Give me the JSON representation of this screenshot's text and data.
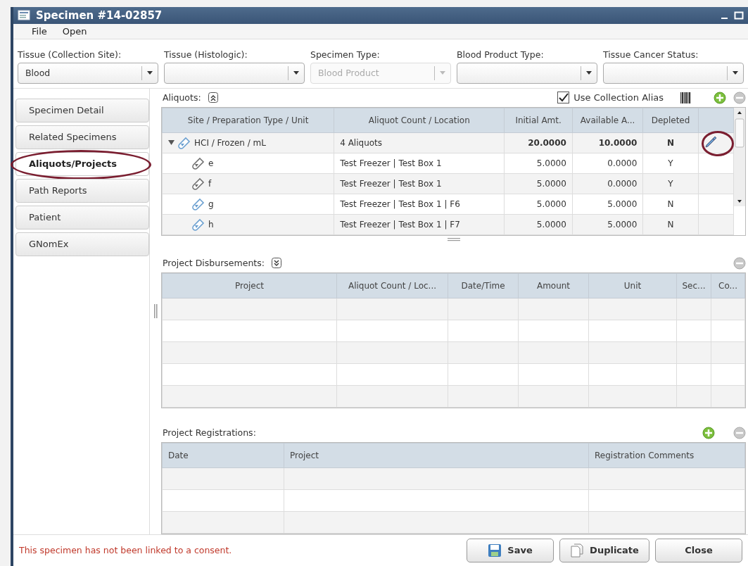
{
  "window": {
    "title": "Specimen #14-02857"
  },
  "menu": [
    "File",
    "Open"
  ],
  "fields": [
    {
      "label": "Tissue (Collection Site):",
      "value": "Blood",
      "disabled": false
    },
    {
      "label": "Tissue (Histologic):",
      "disabled": false
    },
    {
      "label": "Specimen Type:",
      "value": "Blood Product",
      "disabled": true
    },
    {
      "label": "Blood Product Type:",
      "disabled": false
    },
    {
      "label": "Tissue Cancer Status:",
      "disabled": false
    }
  ],
  "sidebar": {
    "items": [
      {
        "label": "Specimen Detail",
        "selected": false,
        "annotated": false
      },
      {
        "label": "Related Specimens",
        "selected": false,
        "annotated": false
      },
      {
        "label": "Aliquots/Projects",
        "selected": true,
        "annotated": true
      },
      {
        "label": "Path Reports",
        "selected": false,
        "annotated": false
      },
      {
        "label": "Patient",
        "selected": false,
        "annotated": false
      },
      {
        "label": "GNomEx",
        "selected": false,
        "annotated": false
      }
    ]
  },
  "aliquots": {
    "title": "Aliquots:",
    "use_collection_alias": {
      "label": "Use Collection Alias",
      "checked": true
    },
    "columns": [
      "Site / Preparation Type / Unit",
      "Aliquot Count / Location",
      "Initial Amt.",
      "Available A...",
      "Depleted"
    ],
    "rows": [
      {
        "kind": "group",
        "site": "HCI / Frozen / mL",
        "count_location": "4 Aliquots",
        "initial": "20.0000",
        "available": "10.0000",
        "depleted": "N",
        "color": "#6a9fd0",
        "expanded": true,
        "annotated": true,
        "children": [
          {
            "kind": "aliquot",
            "site": "e",
            "count_location": "Test Freezer | Test Box 1",
            "initial": "5.0000",
            "available": "0.0000",
            "depleted": "Y",
            "color": "#707070"
          },
          {
            "kind": "aliquot",
            "site": "f",
            "count_location": "Test Freezer | Test Box 1",
            "initial": "5.0000",
            "available": "0.0000",
            "depleted": "Y",
            "color": "#707070"
          },
          {
            "kind": "aliquot",
            "site": "g",
            "count_location": "Test Freezer | Test Box 1 | F6",
            "initial": "5.0000",
            "available": "5.0000",
            "depleted": "N",
            "color": "#6a9fd0"
          },
          {
            "kind": "aliquot",
            "site": "h",
            "count_location": "Test Freezer | Test Box 1 | F7",
            "initial": "5.0000",
            "available": "5.0000",
            "depleted": "N",
            "color": "#6a9fd0"
          }
        ]
      }
    ]
  },
  "disbursements": {
    "title": "Project Disbursements:",
    "columns": [
      "Project",
      "Aliquot Count / Loc...",
      "Date/Time",
      "Amount",
      "Unit",
      "Sec...",
      "Co..."
    ]
  },
  "registrations": {
    "title": "Project Registrations:",
    "columns": [
      "Date",
      "Project",
      "Registration Comments"
    ]
  },
  "footer": {
    "message": "This specimen has not been linked to a consent.",
    "buttons": [
      {
        "label": "Save",
        "kind": "save"
      },
      {
        "label": "Duplicate",
        "kind": "duplicate"
      },
      {
        "label": "Close",
        "kind": "plain"
      }
    ]
  }
}
